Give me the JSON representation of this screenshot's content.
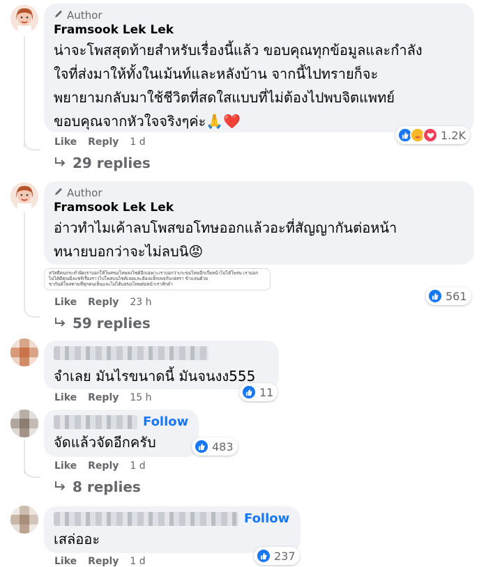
{
  "comments": [
    {
      "badge": "Author",
      "name": "Framsook Lek Lek",
      "text_lines": [
        "น่าจะโพสสุดท้ายสำหรับเรื่องนี้แล้ว ขอบคุณทุกข้อมูลและกำลัง",
        "ใจที่ส่งมาให้ทั้งในเม้นท์และหลังบ้าน จากนี้ไปทรายก็จะ",
        "พยายามกลับมาใช้ชีวิตที่สดใสแบบที่ไม่ต้องไปพบจิตแพทย์",
        "ขอบคุณจากหัวใจจริงๆค่ะ🙏❤️"
      ],
      "like": "Like",
      "reply": "Reply",
      "time": "1 d",
      "reaction_count": "1.2K",
      "replies": "29 replies"
    },
    {
      "badge": "Author",
      "name": "Framsook Lek Lek",
      "text_lines": [
        "อ่าวทำไมเค้าลบโพสขอโทษออกแล้วอะที่สัญญากันต่อหน้า",
        "ทนายบอกว่าจะไม่ลบนิ😡"
      ],
      "attachment_lines": [
        "สวัสดีคนกระทำผิดเราบอกให้โพสขอโทษลงไซต์อีกเฉพาะเราบอกว่าเกะขอโทษอีกเกี่ยหน้าไม่ได้โพรม เราบอก",
        "ไม่ได้ดีคุณยิ่งแชร์เรื่องราวไปโพสบนไซต์เลยและต้องแท็กเพจกับเฟสรา ข้าแลนด้วย",
        "ขากันค์โพสตามที่ทุกคนเห็นและไม่ได้แย่ขอโทษต่อหน้าเราสักคำ"
      ],
      "like": "Like",
      "reply": "Reply",
      "time": "23 h",
      "reaction_count": "561",
      "replies": "59 replies"
    },
    {
      "text": "จำเลย มันไรขนาดนี้ มันจนงง555",
      "like": "Like",
      "reply": "Reply",
      "time": "15 h",
      "reaction_count": "11"
    },
    {
      "follow": "Follow",
      "text": "จัดแล้วจัดอีกครับ",
      "like": "Like",
      "reply": "Reply",
      "time": "1 d",
      "reaction_count": "483",
      "replies": "8 replies"
    },
    {
      "follow": "Follow",
      "text": "เสล่ออะ",
      "like": "Like",
      "reply": "Reply",
      "time": "1 d",
      "reaction_count": "237"
    }
  ],
  "colors": {
    "like_blue": "#1877f2",
    "bubble": "#f0f2f5",
    "muted": "#65676b"
  }
}
